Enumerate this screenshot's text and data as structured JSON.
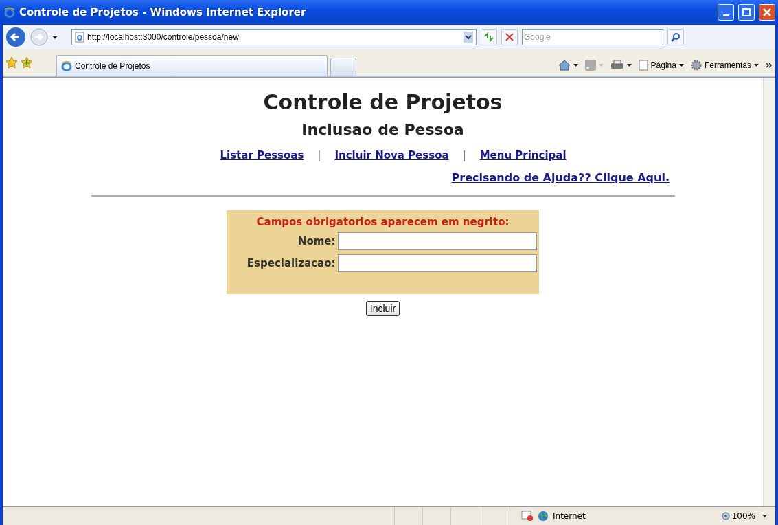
{
  "window": {
    "title": "Controle de Projetos - Windows Internet Explorer"
  },
  "address_bar": {
    "url": "http://localhost:3000/controle/pessoa/new"
  },
  "search": {
    "placeholder": "Google"
  },
  "tabs": [
    {
      "label": "Controle de Projetos",
      "selected": true
    }
  ],
  "command_bar": [
    {
      "kind": "home"
    },
    {
      "kind": "feeds"
    },
    {
      "kind": "print"
    },
    {
      "kind": "page",
      "label": "Página"
    },
    {
      "kind": "tools",
      "label": "Ferramentas"
    }
  ],
  "page": {
    "title": "Controle de Projetos",
    "subtitle": "Inclusao de Pessoa",
    "nav_links": [
      "Listar Pessoas",
      "Incluir Nova Pessoa",
      "Menu Principal"
    ],
    "separator": "|",
    "help_link": "Precisando de Ajuda?? Clique Aqui.",
    "form": {
      "legend": "Campos obrigatorios aparecem em negrito:",
      "fields": [
        {
          "label": "Nome:"
        },
        {
          "label": "Especializacao:"
        }
      ],
      "submit": "Incluir"
    }
  },
  "status_bar": {
    "zone": "Internet",
    "zoom": "100%"
  }
}
